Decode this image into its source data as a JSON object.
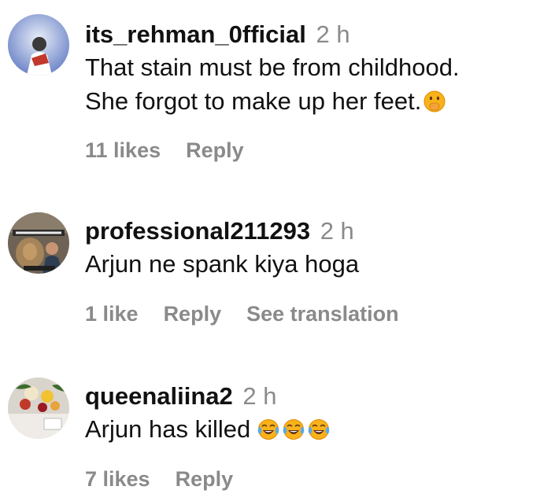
{
  "comments": [
    {
      "username": "its_rehman_0fficial",
      "time": "2 h",
      "lines": [
        "That stain must be from childhood.",
        "She forgot to make up her feet."
      ],
      "emoji": "shushing-face-emoji",
      "likes": "11 likes",
      "reply": "Reply"
    },
    {
      "username": "professional211293",
      "time": "2 h",
      "lines": [
        "Arjun ne spank kiya hoga"
      ],
      "likes": "1 like",
      "reply": "Reply",
      "translate": "See translation"
    },
    {
      "username": "queenaliina2",
      "time": "2 h",
      "lines": [
        "Arjun has killed"
      ],
      "emoji": "tears-of-joy-emoji",
      "likes": "7 likes",
      "reply": "Reply"
    }
  ],
  "colors": {
    "text": "#111111",
    "muted": "#8a8a8a",
    "emoji_yellow": "#f9b21a",
    "tears_blue": "#5aa9e6"
  }
}
